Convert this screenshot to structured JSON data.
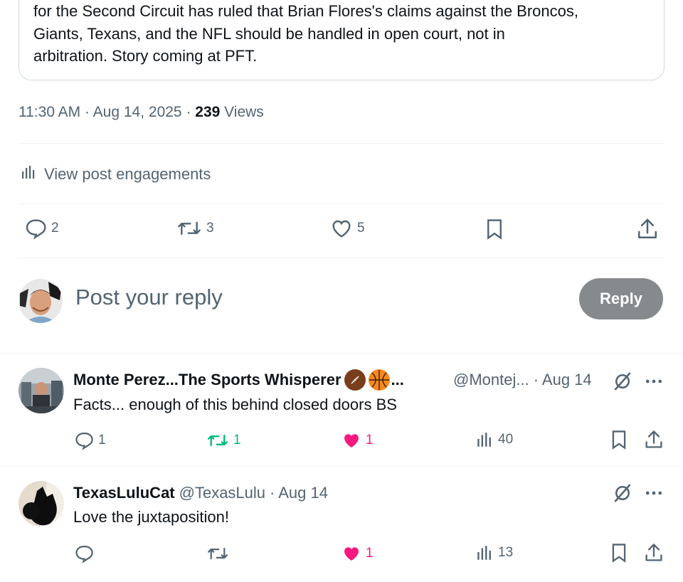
{
  "quote": {
    "text_line1": "for the Second Circuit has ruled that Brian Flores's claims against the Broncos,",
    "text_line2": "Giants, Texans, and the NFL should be handled in open court, not in",
    "text_line3": "arbitration. Story coming at PFT."
  },
  "meta": {
    "time_date": "11:30 AM · Aug 14, 2025 · ",
    "views_count": "239",
    "views_label": " Views"
  },
  "engagements": {
    "label": "View post engagements",
    "icon": "chart-bars-icon"
  },
  "main_actions": {
    "replies": "2",
    "reposts": "3",
    "likes": "5"
  },
  "compose": {
    "placeholder": "Post your reply",
    "button_label": "Reply"
  },
  "replies": [
    {
      "name": "Monte Perez...The Sports Whisperer",
      "name_suffix": "...",
      "handle": "@Montej...",
      "time": "· Aug 14",
      "text": "Facts... enough of this behind closed doors BS",
      "reply_count": "1",
      "repost_count": "1",
      "like_count": "1",
      "views": "40"
    },
    {
      "name": "TexasLuluCat",
      "handle": "@TexasLulu",
      "time": "· Aug 14",
      "text": "Love the juxtaposition!",
      "like_count": "1",
      "views": "13"
    }
  ],
  "colors": {
    "text_primary": "#0f1419",
    "text_secondary": "#536471",
    "repost_active": "#00ba7c",
    "like_active": "#f91880",
    "reply_button_disabled": "#878a8c",
    "divider": "#eff3f4"
  }
}
